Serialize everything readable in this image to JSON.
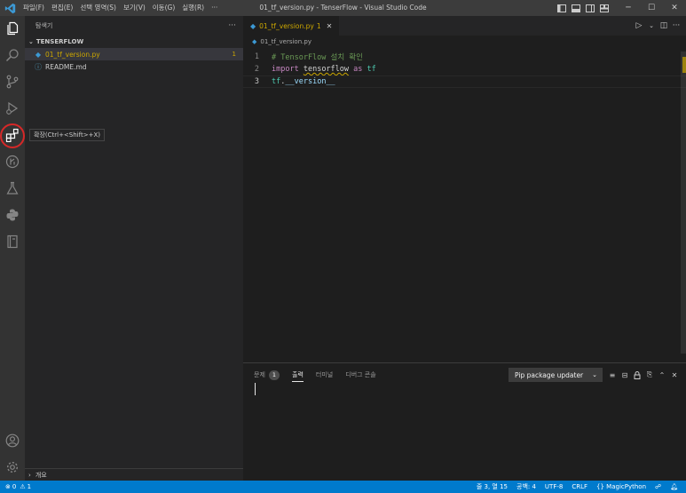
{
  "titlebar": {
    "logo": "vscode-logo",
    "menu": [
      "파일(F)",
      "편집(E)",
      "선택 영역(S)",
      "보기(V)",
      "이동(G)",
      "실행(R)",
      "···"
    ],
    "title": "01_tf_version.py - TenserFlow - Visual Studio Code",
    "controls": [
      "─",
      "☐",
      "✕"
    ]
  },
  "activity": {
    "icons": [
      "explorer-icon",
      "search-icon",
      "source-control-icon",
      "run-debug-icon",
      "extensions-icon",
      "remote-icon",
      "testing-icon",
      "python-icon",
      "notebook-icon",
      "account-icon",
      "settings-icon"
    ],
    "tooltip": "확장(Ctrl+<Shift>+X)"
  },
  "sidebar": {
    "title": "탐색기",
    "more": "···",
    "folder": "TENSERFLOW",
    "files": [
      {
        "name": "01_tf_version.py",
        "badge": "1",
        "icon": "python-file-icon"
      },
      {
        "name": "README.md",
        "badge": "",
        "icon": "info-icon"
      }
    ],
    "outline": "개요"
  },
  "editor": {
    "tab": {
      "name": "01_tf_version.py",
      "badge": "1"
    },
    "breadcrumb": "01_tf_version.py",
    "lines": [
      {
        "num": "1",
        "comment": "# TensorFlow 설치 확인"
      },
      {
        "num": "2",
        "kw": "import",
        "mod": "tensorflow",
        "as": "as",
        "alias": "tf"
      },
      {
        "num": "3",
        "obj": "tf",
        "dot": ".",
        "attr": "__version__"
      }
    ]
  },
  "panel": {
    "tabs": [
      {
        "label": "문제",
        "badge": "1"
      },
      {
        "label": "출력"
      },
      {
        "label": "터미널"
      },
      {
        "label": "디버그 콘솔"
      }
    ],
    "output_channel": "Pip package updater"
  },
  "statusbar": {
    "errors": "0",
    "warnings": "1",
    "position": "줄 3, 열 15",
    "indent": "공백: 4",
    "encoding": "UTF-8",
    "eol": "CRLF",
    "language": "MagicPython"
  },
  "colors": {
    "accent": "#007acc",
    "warning": "#cca700",
    "ring": "#d62828"
  }
}
